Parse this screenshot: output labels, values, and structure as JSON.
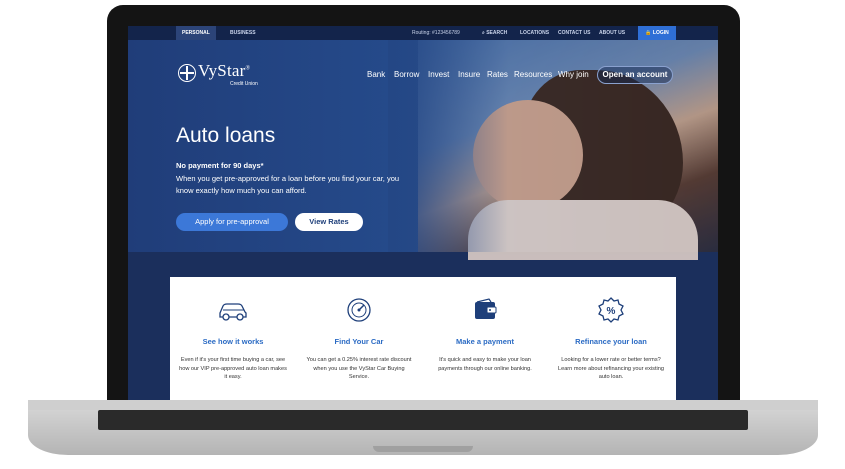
{
  "topbar": {
    "tabs": [
      "PERSONAL",
      "BUSINESS"
    ],
    "routing": "Routing: #123456789",
    "links": [
      "SEARCH",
      "LOCATIONS",
      "CONTACT US",
      "ABOUT US"
    ],
    "login": "LOGIN"
  },
  "brand": {
    "name": "VyStar",
    "registered": "®",
    "sub": "Credit Union"
  },
  "nav": {
    "items": [
      "Bank",
      "Borrow",
      "Invest",
      "Insure",
      "Rates",
      "Resources",
      "Why join"
    ],
    "cta": "Open an account"
  },
  "hero": {
    "title": "Auto loans",
    "promo": "No payment for 90 days*",
    "description": "When you get pre-approved for a loan before you find your car, you know exactly how much you can afford.",
    "primary_btn": "Apply for pre-approval",
    "secondary_btn": "View Rates"
  },
  "cards": [
    {
      "title": "See how it works",
      "text": "Even if it's your first time buying a car, see how our VIP pre-approved auto loan makes it easy.",
      "icon": "car-icon"
    },
    {
      "title": "Find Your Car",
      "text": "You can get a 0.25% interest rate discount when you use the VyStar Car Buying Service.",
      "icon": "speedometer-icon"
    },
    {
      "title": "Make a payment",
      "text": "It's quick and easy to make your loan payments through our online banking.",
      "icon": "wallet-icon"
    },
    {
      "title": "Refinance your loan",
      "text": "Looking for a lower rate or better terms? Learn more about refinancing your existing auto loan.",
      "icon": "percent-badge-icon"
    }
  ],
  "colors": {
    "navy": "#1b2f5c",
    "accent_blue": "#3c78d8",
    "link_blue": "#2b6bc4"
  }
}
